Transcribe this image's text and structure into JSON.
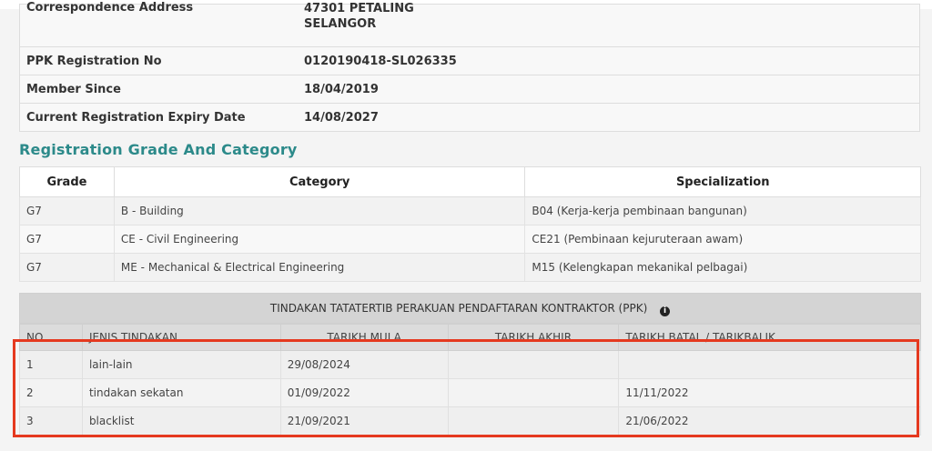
{
  "profile": {
    "rows": [
      {
        "label": "Correspondence Address",
        "value_line1": "47301 PETALING",
        "value_line2": "SELANGOR"
      },
      {
        "label": "PPK Registration No",
        "value": "0120190418-SL026335"
      },
      {
        "label": "Member Since",
        "value": "18/04/2019"
      },
      {
        "label": "Current Registration Expiry Date",
        "value": "14/08/2027"
      }
    ]
  },
  "grade_section": {
    "title": "Registration Grade And Category",
    "headers": {
      "grade": "Grade",
      "category": "Category",
      "specialization": "Specialization"
    },
    "rows": [
      {
        "grade": "G7",
        "category": "B - Building",
        "specialization": "B04 (Kerja-kerja pembinaan bangunan)"
      },
      {
        "grade": "G7",
        "category": "CE - Civil Engineering",
        "specialization": "CE21 (Pembinaan kejuruteraan awam)"
      },
      {
        "grade": "G7",
        "category": "ME - Mechanical & Electrical Engineering",
        "specialization": "M15 (Kelengkapan mekanikal pelbagai)"
      }
    ]
  },
  "discipline": {
    "title": "TINDAKAN TATATERTIB PERAKUAN PENDAFTARAN KONTRAKTOR (PPK)",
    "info_icon": "info-icon",
    "headers": {
      "no": "NO",
      "jenis": "JENIS TINDAKAN",
      "mula": "TARIKH MULA",
      "akhir": "TARIKH AKHIR",
      "batal": "TARIKH BATAL / TARIKBALIK"
    },
    "rows": [
      {
        "no": "1",
        "jenis": "lain-lain",
        "mula": "29/08/2024",
        "akhir": "",
        "batal": ""
      },
      {
        "no": "2",
        "jenis": "tindakan sekatan",
        "mula": "01/09/2022",
        "akhir": "",
        "batal": "11/11/2022"
      },
      {
        "no": "3",
        "jenis": "blacklist",
        "mula": "21/09/2021",
        "akhir": "",
        "batal": "21/06/2022"
      }
    ]
  },
  "colors": {
    "accent_teal": "#2c8a8a",
    "highlight_red": "#e5391f"
  }
}
